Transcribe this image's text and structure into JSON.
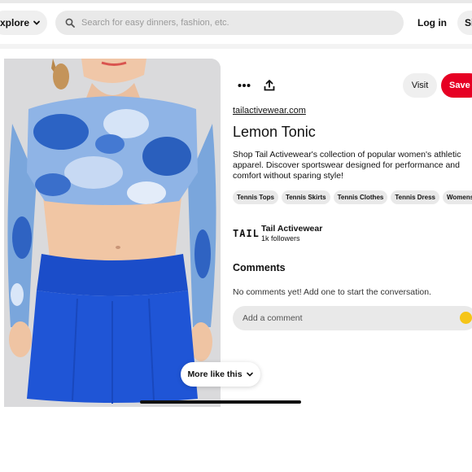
{
  "header": {
    "explore_label": "xplore",
    "search_placeholder": "Search for easy dinners, fashion, etc.",
    "login_label": "Log in",
    "signup_label": "Si"
  },
  "pin": {
    "visit_label": "Visit",
    "save_label": "Save",
    "source": "tailactivewear.com",
    "title": "Lemon Tonic",
    "description": "Shop Tail Activewear's collection of popular women's athletic apparel. Discover sportswear designed for performance and comfort without sparing style!",
    "tags": [
      "Tennis Tops",
      "Tennis Skirts",
      "Tennis Clothes",
      "Tennis Dress",
      "Womens Ath"
    ]
  },
  "creator": {
    "logo_text": "TAIL",
    "name": "Tail Activewear",
    "followers": "1k followers"
  },
  "comments": {
    "heading": "Comments",
    "empty_text": "No comments yet! Add one to start the conversation.",
    "input_placeholder": "Add a comment"
  },
  "more_like_this_label": "More like this",
  "colors": {
    "save_red": "#e60023",
    "pill_gray": "#e9e9e9",
    "garment_blue": "#1d4fd0"
  }
}
